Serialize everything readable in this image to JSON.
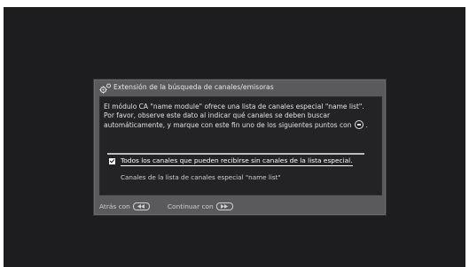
{
  "dialog": {
    "title": "Extensión de la búsqueda de canales/emisoras",
    "description_lines": [
      "El módulo CA \"name module\" ofrece una lista de canales especial \"name list\".",
      "Por favor, observe este dato al indicar qué canales se deben buscar",
      "automáticamente, y marque con este fin uno de los siguientes puntos con"
    ],
    "description_end": ".",
    "options": [
      {
        "label": "Todos los canales que pueden recibirse sin canales de la lista especial.",
        "checked": true
      },
      {
        "label": "Canales de la lista de canales especial \"name list\"",
        "checked": false
      }
    ],
    "footer": {
      "back_label": "Atrás con",
      "continue_label": "Continuar con"
    }
  },
  "icons": {
    "title": "gear-icon",
    "ok_button": "ok-circle-icon",
    "back_key": "rewind-key-icon",
    "continue_key": "fast-forward-key-icon"
  }
}
